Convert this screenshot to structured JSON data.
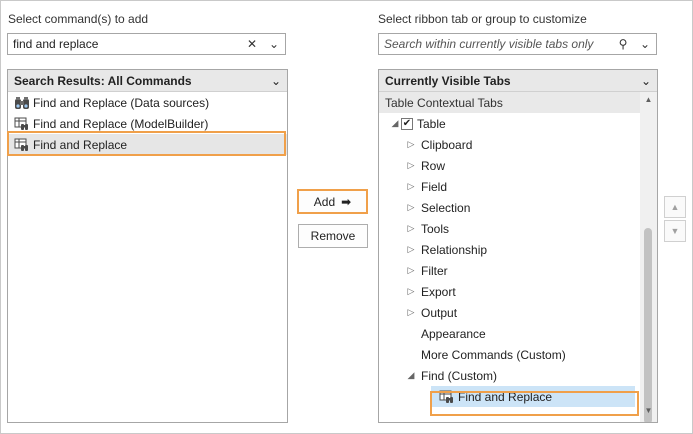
{
  "left": {
    "label": "Select command(s) to add",
    "search_value": "find and replace",
    "clear_glyph": "✕",
    "dropdown_glyph": "⌄",
    "list_header": "Search Results: All Commands",
    "items": [
      {
        "label": "Find and Replace (Data sources)",
        "icon": "binoculars-icon"
      },
      {
        "label": "Find and Replace (ModelBuilder)",
        "icon": "find-replace-icon"
      },
      {
        "label": "Find and Replace",
        "icon": "find-replace-icon",
        "selected": true
      }
    ]
  },
  "middle": {
    "add_label": "Add",
    "add_arrow": "➡",
    "remove_label": "Remove"
  },
  "right": {
    "label": "Select ribbon tab or group to customize",
    "search_placeholder": "Search within currently visible tabs only",
    "search_glyph": "⚲",
    "dropdown_glyph": "⌄",
    "list_header": "Currently Visible Tabs",
    "group_label": "Table Contextual Tabs",
    "tab_label": "Table",
    "tab_checked": true,
    "children": [
      {
        "label": "Clipboard",
        "expander": "▷"
      },
      {
        "label": "Row",
        "expander": "▷"
      },
      {
        "label": "Field",
        "expander": "▷"
      },
      {
        "label": "Selection",
        "expander": "▷"
      },
      {
        "label": "Tools",
        "expander": "▷"
      },
      {
        "label": "Relationship",
        "expander": "▷"
      },
      {
        "label": "Filter",
        "expander": "▷"
      },
      {
        "label": "Export",
        "expander": "▷"
      },
      {
        "label": "Output",
        "expander": "▷"
      },
      {
        "label": "Appearance",
        "expander": ""
      },
      {
        "label": "More Commands (Custom)",
        "expander": ""
      }
    ],
    "custom_group": "Find (Custom)",
    "custom_item": "Find and Replace"
  },
  "colors": {
    "highlight": "#f0a04a",
    "selected_bg": "#cce4f7",
    "header_bg": "#e8e8e8"
  }
}
